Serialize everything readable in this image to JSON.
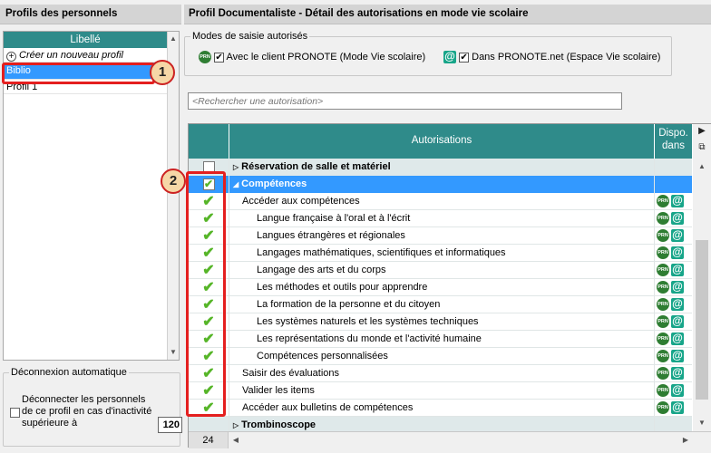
{
  "left_panel": {
    "title": "Profils des personnels",
    "list_header": "Libellé",
    "create_label": "Créer un nouveau profil",
    "profiles": [
      "Biblio",
      "Profil 1"
    ]
  },
  "deconnexion": {
    "title": "Déconnexion automatique",
    "text": "Déconnecter les personnels de ce profil en cas d'inactivité supérieure à",
    "value": "120"
  },
  "right_panel": {
    "title": "Profil  Documentaliste - Détail des autorisations en mode vie scolaire",
    "modes_title": "Modes de saisie autorisés",
    "mode_client": "Avec le client PRONOTE (Mode Vie scolaire)",
    "mode_net": "Dans PRONOTE.net (Espace Vie scolaire)",
    "search_placeholder": "<Rechercher une autorisation>"
  },
  "table": {
    "col_auth": "Autorisations",
    "col_dispo_1": "Dispo.",
    "col_dispo_2": "dans",
    "count": "24",
    "rows": [
      {
        "label": "Réservation de salle et matériel",
        "type": "category"
      },
      {
        "label": "Compétences",
        "type": "selected"
      },
      {
        "label": "Accéder aux compétences",
        "type": "item"
      },
      {
        "label": "Langue française à l'oral et à l'écrit",
        "type": "subitem"
      },
      {
        "label": "Langues étrangères et régionales",
        "type": "subitem"
      },
      {
        "label": "Langages mathématiques, scientifiques et informatiques",
        "type": "subitem"
      },
      {
        "label": "Langage des arts et du corps",
        "type": "subitem"
      },
      {
        "label": "Les méthodes et outils pour apprendre",
        "type": "subitem"
      },
      {
        "label": "La formation de la personne et du citoyen",
        "type": "subitem"
      },
      {
        "label": "Les systèmes naturels et les systèmes techniques",
        "type": "subitem"
      },
      {
        "label": "Les représentations du monde et l'activité humaine",
        "type": "subitem"
      },
      {
        "label": "Compétences personnalisées",
        "type": "subitem"
      },
      {
        "label": "Saisir des évaluations",
        "type": "item"
      },
      {
        "label": "Valider les items",
        "type": "item"
      },
      {
        "label": "Accéder aux bulletins de compétences",
        "type": "item"
      },
      {
        "label": "Trombinoscope",
        "type": "category"
      }
    ]
  },
  "badges": {
    "prn": "PRN",
    "at": "@",
    "check": "✔"
  },
  "callouts": [
    "1",
    "2"
  ]
}
